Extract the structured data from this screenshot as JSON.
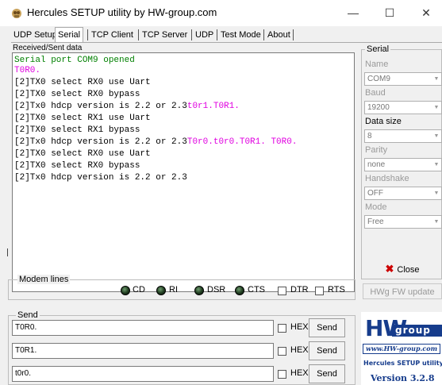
{
  "window": {
    "title": "Hercules SETUP utility by HW-group.com",
    "minimize_glyph": "—",
    "maximize_glyph": "☐",
    "close_glyph": "✕"
  },
  "tabs": [
    "UDP Setup",
    "Serial",
    "TCP Client",
    "TCP Server",
    "UDP",
    "Test Mode",
    "About"
  ],
  "active_tab": "Serial",
  "received": {
    "label": "Received/Sent data",
    "lines": [
      {
        "color": "green",
        "segments": [
          {
            "text": "Serial port COM9 opened",
            "color": "green"
          }
        ]
      },
      {
        "color": "magenta",
        "segments": [
          {
            "text": "T0R0.",
            "color": "magenta"
          }
        ]
      },
      {
        "segments": [
          {
            "text": "[2]TX0 select RX0 use Uart",
            "color": "black"
          }
        ]
      },
      {
        "segments": [
          {
            "text": "[2]TX0 select RX0 bypass",
            "color": "black"
          }
        ]
      },
      {
        "segments": [
          {
            "text": "[2]Tx0 hdcp version is 2.2 or 2.3",
            "color": "black"
          },
          {
            "text": "t0r1.T0R1.",
            "color": "magenta"
          }
        ]
      },
      {
        "segments": [
          {
            "text": "[2]TX0 select RX1 use Uart",
            "color": "black"
          }
        ]
      },
      {
        "segments": [
          {
            "text": "[2]TX0 select RX1 bypass",
            "color": "black"
          }
        ]
      },
      {
        "segments": [
          {
            "text": "[2]Tx0 hdcp version is 2.2 or 2.3",
            "color": "black"
          },
          {
            "text": "T0r0.t0r0.T0R1. T0R0.",
            "color": "magenta"
          }
        ]
      },
      {
        "segments": [
          {
            "text": "[2]TX0 select RX0 use Uart",
            "color": "black"
          }
        ]
      },
      {
        "segments": [
          {
            "text": "[2]TX0 select RX0 bypass",
            "color": "black"
          }
        ]
      },
      {
        "segments": [
          {
            "text": "[2]Tx0 hdcp version is 2.2 or 2.3",
            "color": "black"
          }
        ]
      }
    ]
  },
  "serial": {
    "group_label": "Serial",
    "name_label": "Name",
    "name_value": "COM9",
    "baud_label": "Baud",
    "baud_value": "19200",
    "datasize_label": "Data size",
    "datasize_value": "8",
    "parity_label": "Parity",
    "parity_value": "none",
    "handshake_label": "Handshake",
    "handshake_value": "OFF",
    "mode_label": "Mode",
    "mode_value": "Free",
    "close_label": "Close",
    "fw_update_label": "HWg FW update"
  },
  "modem": {
    "group_label": "Modem lines",
    "leds": [
      "CD",
      "RI",
      "DSR",
      "CTS"
    ],
    "checks": [
      "DTR",
      "RTS"
    ]
  },
  "send": {
    "group_label": "Send",
    "rows": [
      {
        "value": "T0R0.",
        "hex_label": "HEX",
        "button_label": "Send"
      },
      {
        "value": "T0R1.",
        "hex_label": "HEX",
        "button_label": "Send"
      },
      {
        "value": "t0r0.",
        "hex_label": "HEX",
        "button_label": "Send"
      }
    ]
  },
  "logo": {
    "hw": "HW",
    "group": "group",
    "url": "www.HW-group.com",
    "product": "Hercules SETUP utility",
    "version": "Version  3.2.8"
  },
  "colors": {
    "green_text": "#008000",
    "magenta_text": "#e000e0",
    "brand_blue": "#163c8c",
    "close_red": "#cc0000"
  }
}
